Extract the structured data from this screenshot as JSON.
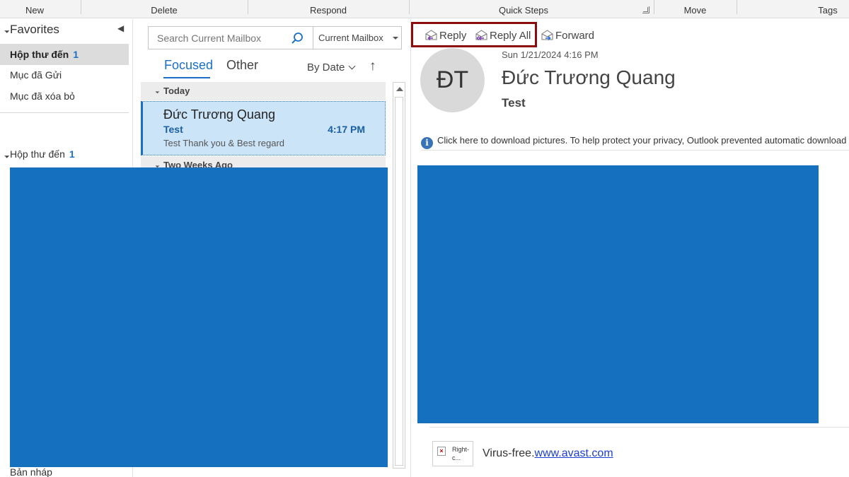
{
  "ribbon": {
    "groups": [
      "New",
      "Delete",
      "Respond",
      "Quick Steps",
      "Move",
      "Tags"
    ]
  },
  "folders": {
    "favorites_label": "Favorites",
    "items": [
      {
        "label": "Hộp thư đến",
        "count": "1"
      },
      {
        "label": "Mục đã Gửi"
      },
      {
        "label": "Mục đã xóa bỏ"
      }
    ],
    "account_inbox_label": "Hộp thư đến",
    "account_inbox_count": "1",
    "drafts_label": "Bản nháp"
  },
  "search": {
    "placeholder": "Search Current Mailbox",
    "scope": "Current Mailbox"
  },
  "message_list": {
    "tabs": [
      "Focused",
      "Other"
    ],
    "sort_label": "By Date",
    "sort_direction": "↑",
    "groups": [
      "Today",
      "Two Weeks Ago"
    ],
    "messages": [
      {
        "sender": "Đức Trương Quang",
        "subject": "Test",
        "time": "4:17 PM",
        "preview": "Test  Thank you & Best regard"
      }
    ]
  },
  "reading_pane": {
    "actions": {
      "reply": "Reply",
      "reply_all": "Reply All",
      "forward": "Forward"
    },
    "date": "Sun 1/21/2024 4:16 PM",
    "avatar_initials": "ĐT",
    "from": "Đức Trương Quang",
    "subject": "Test",
    "notice": "Click here to download pictures. To help protect your privacy, Outlook prevented automatic download of some pictures in this message.",
    "signature_image_alt": "Right-c...",
    "signature_text": "Virus-free.",
    "signature_link": "www.avast.com"
  },
  "colors": {
    "accent": "#1a6fc7",
    "selected_message_bg": "#cce4f7",
    "redaction": "#1570c0",
    "highlight_box": "#8b0c0c"
  }
}
